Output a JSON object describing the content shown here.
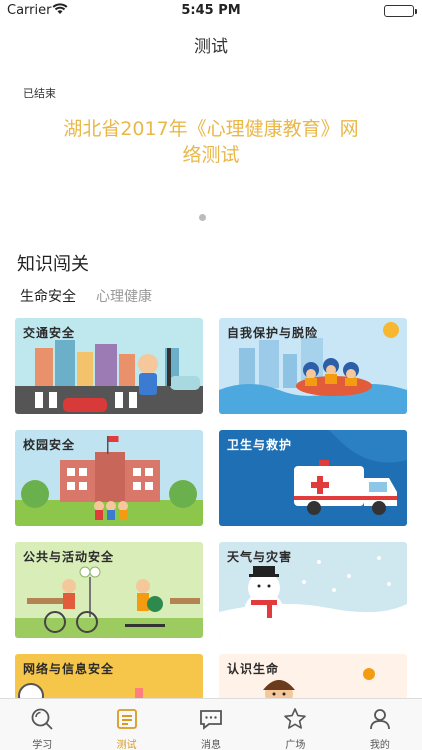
{
  "status": {
    "carrier": "Carrier",
    "time": "5:45 PM"
  },
  "nav": {
    "title": "测试"
  },
  "banner": {
    "state": "已结束",
    "title": "湖北省2017年《心理健康教育》网络测试"
  },
  "section": {
    "title": "知识闯关",
    "tabs": [
      {
        "label": "生命安全",
        "active": true
      },
      {
        "label": "心理健康",
        "active": false
      }
    ]
  },
  "cards": [
    {
      "label": "交通安全",
      "icon": "traffic-illustration"
    },
    {
      "label": "自我保护与脱险",
      "icon": "rescue-boat-illustration"
    },
    {
      "label": "校园安全",
      "icon": "school-illustration"
    },
    {
      "label": "卫生与救护",
      "icon": "ambulance-illustration"
    },
    {
      "label": "公共与活动安全",
      "icon": "playground-illustration"
    },
    {
      "label": "天气与灾害",
      "icon": "snowman-illustration"
    },
    {
      "label": "网络与信息安全",
      "icon": "network-illustration"
    },
    {
      "label": "认识生命",
      "icon": "child-illustration"
    }
  ],
  "tabbar": [
    {
      "label": "学习",
      "icon": "search-icon",
      "active": false
    },
    {
      "label": "测试",
      "icon": "test-icon",
      "active": true
    },
    {
      "label": "消息",
      "icon": "message-icon",
      "active": false
    },
    {
      "label": "广场",
      "icon": "star-icon",
      "active": false
    },
    {
      "label": "我的",
      "icon": "profile-icon",
      "active": false
    }
  ],
  "colors": {
    "accent": "#e9b84a",
    "tab_active": "#d89a20"
  }
}
